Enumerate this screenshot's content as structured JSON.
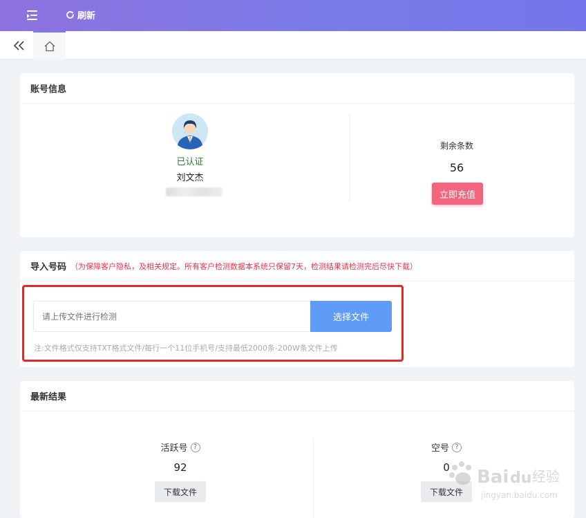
{
  "topbar": {
    "refresh_label": "刷新"
  },
  "account": {
    "title": "账号信息",
    "status": "已认证",
    "name": "刘文杰",
    "remain_label": "剩余条数",
    "remain_value": "56",
    "recharge_label": "立即充值"
  },
  "import": {
    "title": "导入号码",
    "notice": "（为保障客户隐私，及相关规定。所有客户检测数据本系统只保留7天，检测结果请检测完后尽快下载）",
    "input_placeholder": "请上传文件进行检测",
    "choose_label": "选择文件",
    "hint": "注:文件格式仅支持TXT格式文件/每行一个11位手机号/支持最低2000条-200W条文件上传"
  },
  "results": {
    "title": "最新结果",
    "items": [
      {
        "label": "活跃号",
        "value": "92",
        "download_label": "下载文件"
      },
      {
        "label": "空号",
        "value": "0",
        "download_label": "下载文件"
      }
    ]
  },
  "watermark": {
    "text": "jingyan.baidu.com"
  },
  "colors": {
    "topbar": "#7a7be8",
    "recharge": "#f2657f",
    "choose": "#5f9cf7",
    "notice": "#e8334a"
  }
}
